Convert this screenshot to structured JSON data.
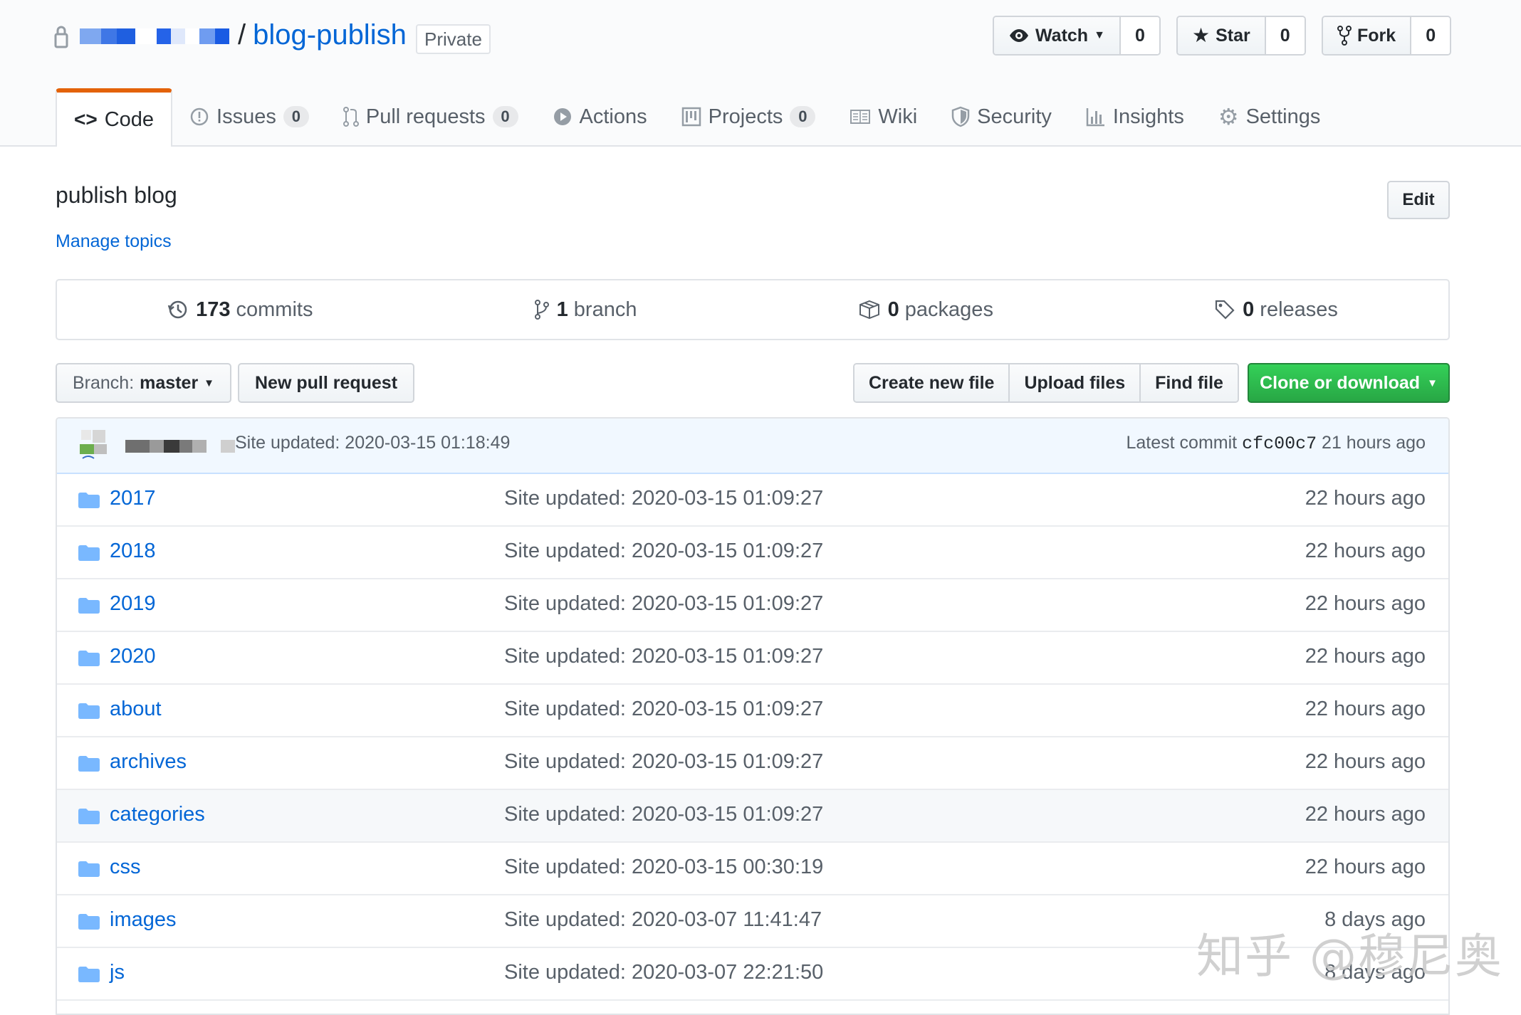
{
  "repo": {
    "owner_blurred": true,
    "separator": "/",
    "name": "blog-publish",
    "visibility": "Private"
  },
  "actions": {
    "watch": {
      "label": "Watch",
      "count": "0"
    },
    "star": {
      "label": "Star",
      "count": "0"
    },
    "fork": {
      "label": "Fork",
      "count": "0"
    }
  },
  "tabs": [
    {
      "label": "Code",
      "icon": "code-icon",
      "selected": true
    },
    {
      "label": "Issues",
      "icon": "issue-icon",
      "count": "0"
    },
    {
      "label": "Pull requests",
      "icon": "pull-request-icon",
      "count": "0"
    },
    {
      "label": "Actions",
      "icon": "play-icon"
    },
    {
      "label": "Projects",
      "icon": "project-icon",
      "count": "0"
    },
    {
      "label": "Wiki",
      "icon": "book-icon"
    },
    {
      "label": "Security",
      "icon": "shield-icon"
    },
    {
      "label": "Insights",
      "icon": "graph-icon"
    },
    {
      "label": "Settings",
      "icon": "gear-icon"
    }
  ],
  "description": "publish blog",
  "manage_topics": "Manage topics",
  "edit_label": "Edit",
  "summary": {
    "commits": {
      "count": "173",
      "label": "commits"
    },
    "branches": {
      "count": "1",
      "label": "branch"
    },
    "packages": {
      "count": "0",
      "label": "packages"
    },
    "releases": {
      "count": "0",
      "label": "releases"
    }
  },
  "file_nav": {
    "branch_label": "Branch:",
    "branch_value": "master",
    "new_pull_request": "New pull request",
    "create_new_file": "Create new file",
    "upload_files": "Upload files",
    "find_file": "Find file",
    "clone_or_download": "Clone or download"
  },
  "latest_commit": {
    "message": "Site updated: 2020-03-15 01:18:49",
    "prefix": "Latest commit",
    "sha": "cfc00c7",
    "age": "21 hours ago"
  },
  "files": [
    {
      "name": "2017",
      "message": "Site updated: 2020-03-15 01:09:27",
      "age": "22 hours ago"
    },
    {
      "name": "2018",
      "message": "Site updated: 2020-03-15 01:09:27",
      "age": "22 hours ago"
    },
    {
      "name": "2019",
      "message": "Site updated: 2020-03-15 01:09:27",
      "age": "22 hours ago"
    },
    {
      "name": "2020",
      "message": "Site updated: 2020-03-15 01:09:27",
      "age": "22 hours ago"
    },
    {
      "name": "about",
      "message": "Site updated: 2020-03-15 01:09:27",
      "age": "22 hours ago"
    },
    {
      "name": "archives",
      "message": "Site updated: 2020-03-15 01:09:27",
      "age": "22 hours ago"
    },
    {
      "name": "categories",
      "message": "Site updated: 2020-03-15 01:09:27",
      "age": "22 hours ago"
    },
    {
      "name": "css",
      "message": "Site updated: 2020-03-15 00:30:19",
      "age": "22 hours ago"
    },
    {
      "name": "images",
      "message": "Site updated: 2020-03-07 11:41:47",
      "age": "8 days ago"
    },
    {
      "name": "js",
      "message": "Site updated: 2020-03-07 22:21:50",
      "age": "8 days ago"
    }
  ],
  "watermark": "知乎 @穆尼奥",
  "colors": {
    "link": "#0366d6",
    "tab_accent": "#e36209",
    "clone_green": "#28a745",
    "folder": "#79b8ff"
  }
}
